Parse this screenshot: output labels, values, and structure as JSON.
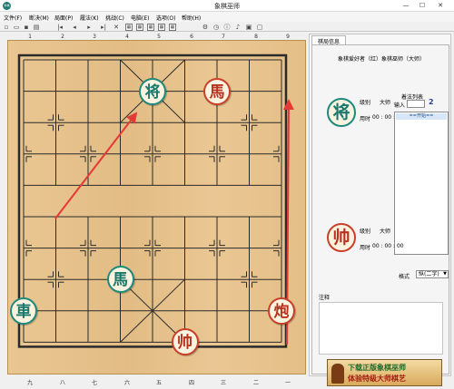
{
  "window": {
    "title": "象棋巫师",
    "app_icon": "象棋",
    "minimize": "—",
    "maximize": "☐",
    "close": "✕"
  },
  "menu": [
    "文件(F)",
    "断决(M)",
    "局面(P)",
    "履法(K)",
    "挑战(C)",
    "电脑(E)",
    "选项(O)",
    "帮助(H)"
  ],
  "toolbar_icons": [
    "new-icon",
    "open-icon",
    "save-icon",
    "print-icon",
    "first-icon",
    "prev-icon",
    "next-icon",
    "last-icon",
    "delete-icon",
    "board-icon",
    "board-icon",
    "board-icon",
    "board-icon",
    "board-icon",
    "settings-icon",
    "clock-icon",
    "info-icon",
    "sound-icon",
    "image-icon",
    "screen-icon"
  ],
  "coords": {
    "top": [
      "1",
      "2",
      "3",
      "4",
      "5",
      "6",
      "7",
      "8",
      "9"
    ],
    "bottom": [
      "九",
      "八",
      "七",
      "六",
      "五",
      "四",
      "三",
      "二",
      "一"
    ]
  },
  "pieces": [
    {
      "char": "将",
      "side": "green",
      "file": 4,
      "rank": 1
    },
    {
      "char": "馬",
      "side": "red",
      "file": 6,
      "rank": 1
    },
    {
      "char": "馬",
      "side": "green",
      "file": 3,
      "rank": 7
    },
    {
      "char": "車",
      "side": "green",
      "file": 0,
      "rank": 8
    },
    {
      "char": "帅",
      "side": "red",
      "file": 5,
      "rank": 9
    },
    {
      "char": "炮",
      "side": "red",
      "file": 8,
      "rank": 8
    }
  ],
  "arrow_color": "#e53935",
  "side_panel": {
    "tab": "棋局信息",
    "match_title": "象棋爱好者（红）象棋巫师（大师）",
    "black_player": {
      "avatar": "将",
      "level_label": "级别",
      "level_value": "大师",
      "time_label": "用时",
      "time_value": "00 : 00 : 00"
    },
    "red_player": {
      "avatar": "帅",
      "level_label": "级别",
      "level_value": "大师",
      "time_label": "用时",
      "time_value": "00 : 00 : 00"
    },
    "moves_list_label": "着法列表",
    "input_label": "输入",
    "step_value": "2",
    "moves_selected": "==开始==",
    "format_label": "格式",
    "format_value": "纵(二字)",
    "notes_label": "注释",
    "banner_line1": "下载正版象棋巫师",
    "banner_line2": "体验特级大师棋艺"
  }
}
